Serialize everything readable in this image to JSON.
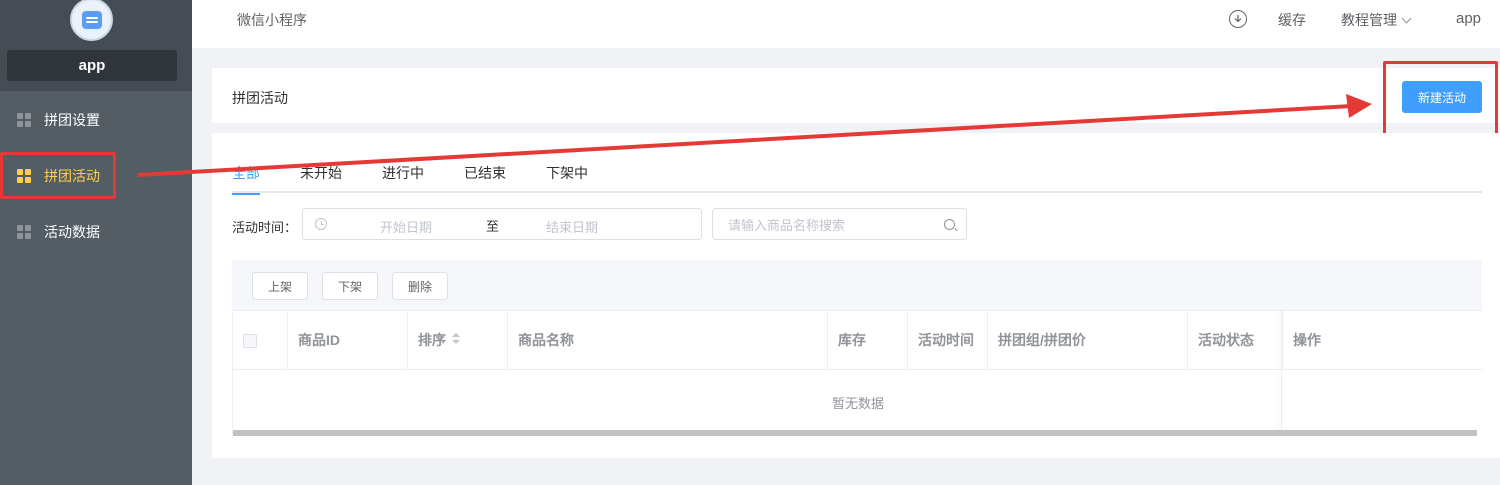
{
  "sidebar": {
    "app_name": "app",
    "items": [
      {
        "label": "拼团设置",
        "active": false
      },
      {
        "label": "拼团活动",
        "active": true
      },
      {
        "label": "活动数据",
        "active": false
      }
    ]
  },
  "header": {
    "title": "微信小程序",
    "cache_label": "缓存",
    "tutorial_label": "教程管理",
    "user_label": "app"
  },
  "page": {
    "title": "拼团活动",
    "new_button": "新建活动"
  },
  "tabs": [
    {
      "label": "全部",
      "active": true
    },
    {
      "label": "未开始",
      "active": false
    },
    {
      "label": "进行中",
      "active": false
    },
    {
      "label": "已结束",
      "active": false
    },
    {
      "label": "下架中",
      "active": false
    }
  ],
  "filter": {
    "label": "活动时间：",
    "start_placeholder": "开始日期",
    "separator": "至",
    "end_placeholder": "结束日期",
    "search_placeholder": "请输入商品名称搜索"
  },
  "actions": {
    "up": "上架",
    "down": "下架",
    "delete": "删除"
  },
  "table": {
    "columns": [
      "商品ID",
      "排序",
      "商品名称",
      "库存",
      "活动时间",
      "拼团组/拼团价",
      "活动状态",
      "操作"
    ],
    "empty_text": "暂无数据"
  },
  "colors": {
    "sidebar_bg": "#545c64",
    "active_menu": "#ffd04b",
    "primary": "#409eff",
    "annotation_red": "#e53935"
  },
  "icons": {
    "menu": "grid-icon",
    "header_download": "download-icon",
    "date": "clock-icon",
    "search": "search-icon",
    "sort": "sort-icon"
  }
}
